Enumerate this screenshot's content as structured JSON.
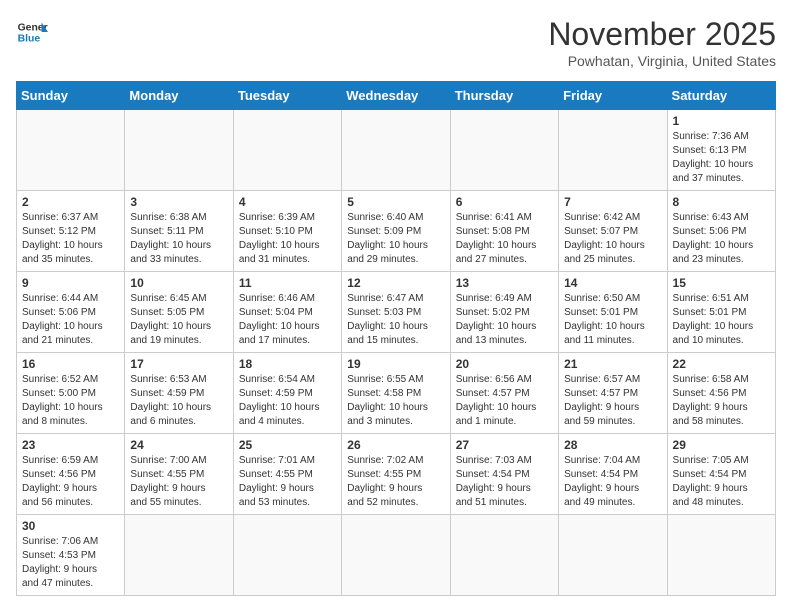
{
  "header": {
    "logo_line1": "General",
    "logo_line2": "Blue",
    "title": "November 2025",
    "subtitle": "Powhatan, Virginia, United States"
  },
  "weekdays": [
    "Sunday",
    "Monday",
    "Tuesday",
    "Wednesday",
    "Thursday",
    "Friday",
    "Saturday"
  ],
  "weeks": [
    [
      {
        "day": "",
        "info": ""
      },
      {
        "day": "",
        "info": ""
      },
      {
        "day": "",
        "info": ""
      },
      {
        "day": "",
        "info": ""
      },
      {
        "day": "",
        "info": ""
      },
      {
        "day": "",
        "info": ""
      },
      {
        "day": "1",
        "info": "Sunrise: 7:36 AM\nSunset: 6:13 PM\nDaylight: 10 hours\nand 37 minutes."
      }
    ],
    [
      {
        "day": "2",
        "info": "Sunrise: 6:37 AM\nSunset: 5:12 PM\nDaylight: 10 hours\nand 35 minutes."
      },
      {
        "day": "3",
        "info": "Sunrise: 6:38 AM\nSunset: 5:11 PM\nDaylight: 10 hours\nand 33 minutes."
      },
      {
        "day": "4",
        "info": "Sunrise: 6:39 AM\nSunset: 5:10 PM\nDaylight: 10 hours\nand 31 minutes."
      },
      {
        "day": "5",
        "info": "Sunrise: 6:40 AM\nSunset: 5:09 PM\nDaylight: 10 hours\nand 29 minutes."
      },
      {
        "day": "6",
        "info": "Sunrise: 6:41 AM\nSunset: 5:08 PM\nDaylight: 10 hours\nand 27 minutes."
      },
      {
        "day": "7",
        "info": "Sunrise: 6:42 AM\nSunset: 5:07 PM\nDaylight: 10 hours\nand 25 minutes."
      },
      {
        "day": "8",
        "info": "Sunrise: 6:43 AM\nSunset: 5:06 PM\nDaylight: 10 hours\nand 23 minutes."
      }
    ],
    [
      {
        "day": "9",
        "info": "Sunrise: 6:44 AM\nSunset: 5:06 PM\nDaylight: 10 hours\nand 21 minutes."
      },
      {
        "day": "10",
        "info": "Sunrise: 6:45 AM\nSunset: 5:05 PM\nDaylight: 10 hours\nand 19 minutes."
      },
      {
        "day": "11",
        "info": "Sunrise: 6:46 AM\nSunset: 5:04 PM\nDaylight: 10 hours\nand 17 minutes."
      },
      {
        "day": "12",
        "info": "Sunrise: 6:47 AM\nSunset: 5:03 PM\nDaylight: 10 hours\nand 15 minutes."
      },
      {
        "day": "13",
        "info": "Sunrise: 6:49 AM\nSunset: 5:02 PM\nDaylight: 10 hours\nand 13 minutes."
      },
      {
        "day": "14",
        "info": "Sunrise: 6:50 AM\nSunset: 5:01 PM\nDaylight: 10 hours\nand 11 minutes."
      },
      {
        "day": "15",
        "info": "Sunrise: 6:51 AM\nSunset: 5:01 PM\nDaylight: 10 hours\nand 10 minutes."
      }
    ],
    [
      {
        "day": "16",
        "info": "Sunrise: 6:52 AM\nSunset: 5:00 PM\nDaylight: 10 hours\nand 8 minutes."
      },
      {
        "day": "17",
        "info": "Sunrise: 6:53 AM\nSunset: 4:59 PM\nDaylight: 10 hours\nand 6 minutes."
      },
      {
        "day": "18",
        "info": "Sunrise: 6:54 AM\nSunset: 4:59 PM\nDaylight: 10 hours\nand 4 minutes."
      },
      {
        "day": "19",
        "info": "Sunrise: 6:55 AM\nSunset: 4:58 PM\nDaylight: 10 hours\nand 3 minutes."
      },
      {
        "day": "20",
        "info": "Sunrise: 6:56 AM\nSunset: 4:57 PM\nDaylight: 10 hours\nand 1 minute."
      },
      {
        "day": "21",
        "info": "Sunrise: 6:57 AM\nSunset: 4:57 PM\nDaylight: 9 hours\nand 59 minutes."
      },
      {
        "day": "22",
        "info": "Sunrise: 6:58 AM\nSunset: 4:56 PM\nDaylight: 9 hours\nand 58 minutes."
      }
    ],
    [
      {
        "day": "23",
        "info": "Sunrise: 6:59 AM\nSunset: 4:56 PM\nDaylight: 9 hours\nand 56 minutes."
      },
      {
        "day": "24",
        "info": "Sunrise: 7:00 AM\nSunset: 4:55 PM\nDaylight: 9 hours\nand 55 minutes."
      },
      {
        "day": "25",
        "info": "Sunrise: 7:01 AM\nSunset: 4:55 PM\nDaylight: 9 hours\nand 53 minutes."
      },
      {
        "day": "26",
        "info": "Sunrise: 7:02 AM\nSunset: 4:55 PM\nDaylight: 9 hours\nand 52 minutes."
      },
      {
        "day": "27",
        "info": "Sunrise: 7:03 AM\nSunset: 4:54 PM\nDaylight: 9 hours\nand 51 minutes."
      },
      {
        "day": "28",
        "info": "Sunrise: 7:04 AM\nSunset: 4:54 PM\nDaylight: 9 hours\nand 49 minutes."
      },
      {
        "day": "29",
        "info": "Sunrise: 7:05 AM\nSunset: 4:54 PM\nDaylight: 9 hours\nand 48 minutes."
      }
    ],
    [
      {
        "day": "30",
        "info": "Sunrise: 7:06 AM\nSunset: 4:53 PM\nDaylight: 9 hours\nand 47 minutes."
      },
      {
        "day": "",
        "info": ""
      },
      {
        "day": "",
        "info": ""
      },
      {
        "day": "",
        "info": ""
      },
      {
        "day": "",
        "info": ""
      },
      {
        "day": "",
        "info": ""
      },
      {
        "day": "",
        "info": ""
      }
    ]
  ]
}
